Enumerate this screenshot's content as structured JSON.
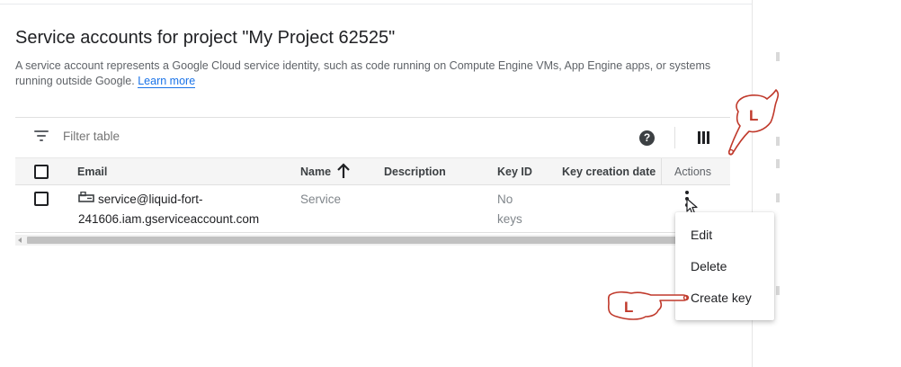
{
  "page": {
    "title": "Service accounts for project \"My Project 62525\"",
    "description": "A service account represents a Google Cloud service identity, such as code running on Compute Engine VMs, App Engine apps, or systems running outside Google.",
    "learn_more": "Learn more"
  },
  "toolbar": {
    "filter_placeholder": "Filter table",
    "help_icon": "help-icon",
    "columns_icon": "column-display-icon"
  },
  "table": {
    "columns": {
      "email": "Email",
      "name": "Name",
      "description": "Description",
      "key_id": "Key ID",
      "key_creation_date": "Key creation date",
      "actions": "Actions"
    },
    "sort": {
      "column": "Name",
      "direction": "ascending"
    },
    "rows": [
      {
        "email_line1": "service@liquid-fort-",
        "email_line2": "241606.iam.gserviceaccount.com",
        "name": "Service",
        "description": "",
        "key_id_line1": "No",
        "key_id_line2": "keys",
        "key_creation_date": ""
      }
    ]
  },
  "actions_menu": {
    "items": [
      "Edit",
      "Delete",
      "Create key"
    ]
  },
  "annotations": {
    "hand_letter": "L",
    "hand_color": "#c0392b"
  }
}
